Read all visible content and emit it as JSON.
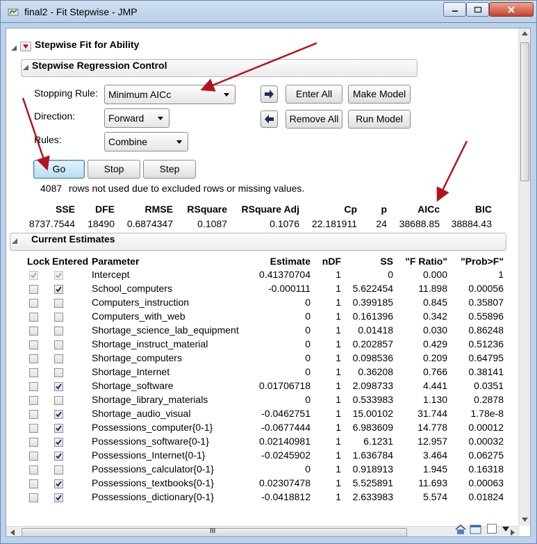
{
  "window": {
    "title": "final2 - Fit Stepwise - JMP"
  },
  "report": {
    "outline_title": "Stepwise Fit for Ability",
    "control": {
      "title": "Stepwise Regression Control",
      "stopping_rule_label": "Stopping Rule:",
      "stopping_rule_value": "Minimum AICc",
      "direction_label": "Direction:",
      "direction_value": "Forward",
      "rules_label": "Rules:",
      "rules_value": "Combine",
      "enter_all": "Enter All",
      "make_model": "Make Model",
      "remove_all": "Remove All",
      "run_model": "Run Model",
      "go": "Go",
      "stop": "Stop",
      "step": "Step",
      "excluded_count": "4087",
      "excluded_text": "rows not used due to excluded rows or missing values."
    },
    "stats": {
      "headers": [
        "SSE",
        "DFE",
        "RMSE",
        "RSquare",
        "RSquare Adj",
        "Cp",
        "p",
        "AICc",
        "BIC"
      ],
      "values": [
        "8737.7544",
        "18490",
        "0.6874347",
        "0.1087",
        "0.1076",
        "22.181911",
        "24",
        "38688.85",
        "38884.43"
      ]
    },
    "estimates": {
      "title": "Current Estimates",
      "headers": {
        "lock": "Lock",
        "entered": "Entered",
        "parameter": "Parameter",
        "estimate": "Estimate",
        "ndf": "nDF",
        "ss": "SS",
        "fratio": "\"F Ratio\"",
        "prob": "\"Prob>F\""
      },
      "rows": [
        {
          "parameter": "Intercept",
          "estimate": "0.41370704",
          "ndf": "1",
          "ss": "0",
          "fratio": "0.000",
          "prob": "1",
          "lock": true,
          "entered": true,
          "disabled": true
        },
        {
          "parameter": "School_computers",
          "estimate": "-0.000111",
          "ndf": "1",
          "ss": "5.622454",
          "fratio": "11.898",
          "prob": "0.00056",
          "lock": false,
          "entered": true,
          "disabled": false
        },
        {
          "parameter": "Computers_instruction",
          "estimate": "0",
          "ndf": "1",
          "ss": "0.399185",
          "fratio": "0.845",
          "prob": "0.35807",
          "lock": false,
          "entered": false,
          "disabled": false
        },
        {
          "parameter": "Computers_with_web",
          "estimate": "0",
          "ndf": "1",
          "ss": "0.161396",
          "fratio": "0.342",
          "prob": "0.55896",
          "lock": false,
          "entered": false,
          "disabled": false
        },
        {
          "parameter": "Shortage_science_lab_equipment",
          "estimate": "0",
          "ndf": "1",
          "ss": "0.01418",
          "fratio": "0.030",
          "prob": "0.86248",
          "lock": false,
          "entered": false,
          "disabled": false
        },
        {
          "parameter": "Shortage_instruct_material",
          "estimate": "0",
          "ndf": "1",
          "ss": "0.202857",
          "fratio": "0.429",
          "prob": "0.51236",
          "lock": false,
          "entered": false,
          "disabled": false
        },
        {
          "parameter": "Shortage_computers",
          "estimate": "0",
          "ndf": "1",
          "ss": "0.098536",
          "fratio": "0.209",
          "prob": "0.64795",
          "lock": false,
          "entered": false,
          "disabled": false
        },
        {
          "parameter": "Shortage_Internet",
          "estimate": "0",
          "ndf": "1",
          "ss": "0.36208",
          "fratio": "0.766",
          "prob": "0.38141",
          "lock": false,
          "entered": false,
          "disabled": false
        },
        {
          "parameter": "Shortage_software",
          "estimate": "0.01706718",
          "ndf": "1",
          "ss": "2.098733",
          "fratio": "4.441",
          "prob": "0.0351",
          "lock": false,
          "entered": true,
          "disabled": false
        },
        {
          "parameter": "Shortage_library_materials",
          "estimate": "0",
          "ndf": "1",
          "ss": "0.533983",
          "fratio": "1.130",
          "prob": "0.2878",
          "lock": false,
          "entered": false,
          "disabled": false
        },
        {
          "parameter": "Shortage_audio_visual",
          "estimate": "-0.0462751",
          "ndf": "1",
          "ss": "15.00102",
          "fratio": "31.744",
          "prob": "1.78e-8",
          "lock": false,
          "entered": true,
          "disabled": false
        },
        {
          "parameter": "Possessions_computer{0-1}",
          "estimate": "-0.0677444",
          "ndf": "1",
          "ss": "6.983609",
          "fratio": "14.778",
          "prob": "0.00012",
          "lock": false,
          "entered": true,
          "disabled": false
        },
        {
          "parameter": "Possessions_software{0-1}",
          "estimate": "0.02140981",
          "ndf": "1",
          "ss": "6.1231",
          "fratio": "12.957",
          "prob": "0.00032",
          "lock": false,
          "entered": true,
          "disabled": false
        },
        {
          "parameter": "Possessions_Internet{0-1}",
          "estimate": "-0.0245902",
          "ndf": "1",
          "ss": "1.636784",
          "fratio": "3.464",
          "prob": "0.06275",
          "lock": false,
          "entered": true,
          "disabled": false
        },
        {
          "parameter": "Possessions_calculator{0-1}",
          "estimate": "0",
          "ndf": "1",
          "ss": "0.918913",
          "fratio": "1.945",
          "prob": "0.16318",
          "lock": false,
          "entered": false,
          "disabled": false
        },
        {
          "parameter": "Possessions_textbooks{0-1}",
          "estimate": "0.02307478",
          "ndf": "1",
          "ss": "5.525891",
          "fratio": "11.693",
          "prob": "0.00063",
          "lock": false,
          "entered": true,
          "disabled": false
        },
        {
          "parameter": "Possessions_dictionary{0-1}",
          "estimate": "-0.0418812",
          "ndf": "1",
          "ss": "2.633983",
          "fratio": "5.574",
          "prob": "0.01824",
          "lock": false,
          "entered": true,
          "disabled": false
        }
      ]
    }
  },
  "scrollbar": {
    "grip": "III"
  },
  "colors": {
    "annotation_arrow": "#b3121f",
    "checkmark": "#1b2a6b"
  }
}
